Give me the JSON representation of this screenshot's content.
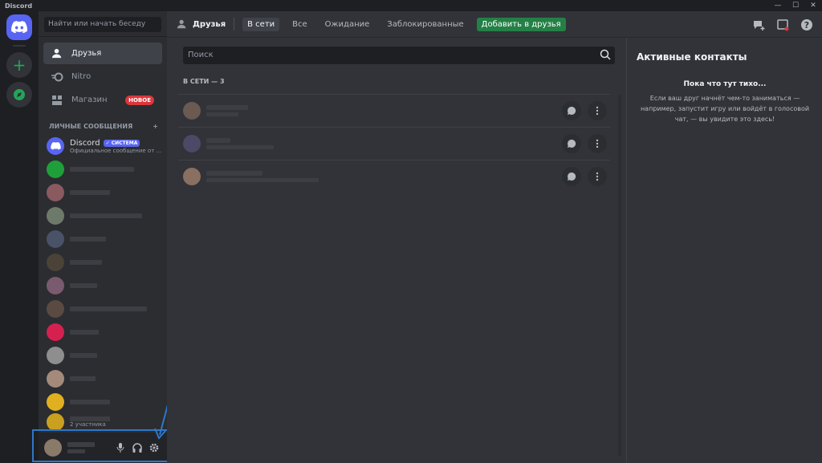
{
  "app": {
    "title": "Discord"
  },
  "colors": {
    "brand": "#5865f2",
    "green": "#248046",
    "red": "#da373c",
    "highlight": "#2e77c9"
  },
  "sidebar": {
    "search_placeholder": "Найти или начать беседу",
    "nav": [
      {
        "label": "Друзья",
        "icon": "friends-icon",
        "active": true
      },
      {
        "label": "Nitro",
        "icon": "nitro-icon"
      },
      {
        "label": "Магазин",
        "icon": "shop-icon",
        "badge": "НОВОЕ"
      }
    ],
    "dm_header": "ЛИЧНЫЕ СООБЩЕНИЯ",
    "dm_add": "+",
    "dms": [
      {
        "name": "Discord",
        "tag": "СИСТЕМА",
        "subtitle": "Официальное сообщение от ..."
      },
      {
        "name": "",
        "subtitle": ""
      },
      {
        "name": "",
        "subtitle": ""
      },
      {
        "name": "",
        "subtitle": ""
      },
      {
        "name": "",
        "subtitle": ""
      },
      {
        "name": "",
        "subtitle": ""
      },
      {
        "name": "",
        "subtitle": ""
      },
      {
        "name": "",
        "subtitle": ""
      },
      {
        "name": "",
        "subtitle": ""
      },
      {
        "name": "",
        "subtitle": ""
      },
      {
        "name": "",
        "subtitle": ""
      },
      {
        "name": "",
        "subtitle": ""
      },
      {
        "name": "",
        "subtitle": "2 участника"
      }
    ]
  },
  "topbar": {
    "title": "Друзья",
    "tabs": [
      "В сети",
      "Все",
      "Ожидание",
      "Заблокированные"
    ],
    "active_tab": "В сети",
    "add_friend": "Добавить в друзья"
  },
  "friends": {
    "search_placeholder": "Поиск",
    "online_header": "В СЕТИ — 3"
  },
  "active_contacts": {
    "title": "Активные контакты",
    "quiet_title": "Пока что тут тихо...",
    "quiet_desc": "Если ваш друг начнёт чем-то заниматься — например, запустит игру или войдёт в голосовой чат, — вы увидите это здесь!"
  }
}
